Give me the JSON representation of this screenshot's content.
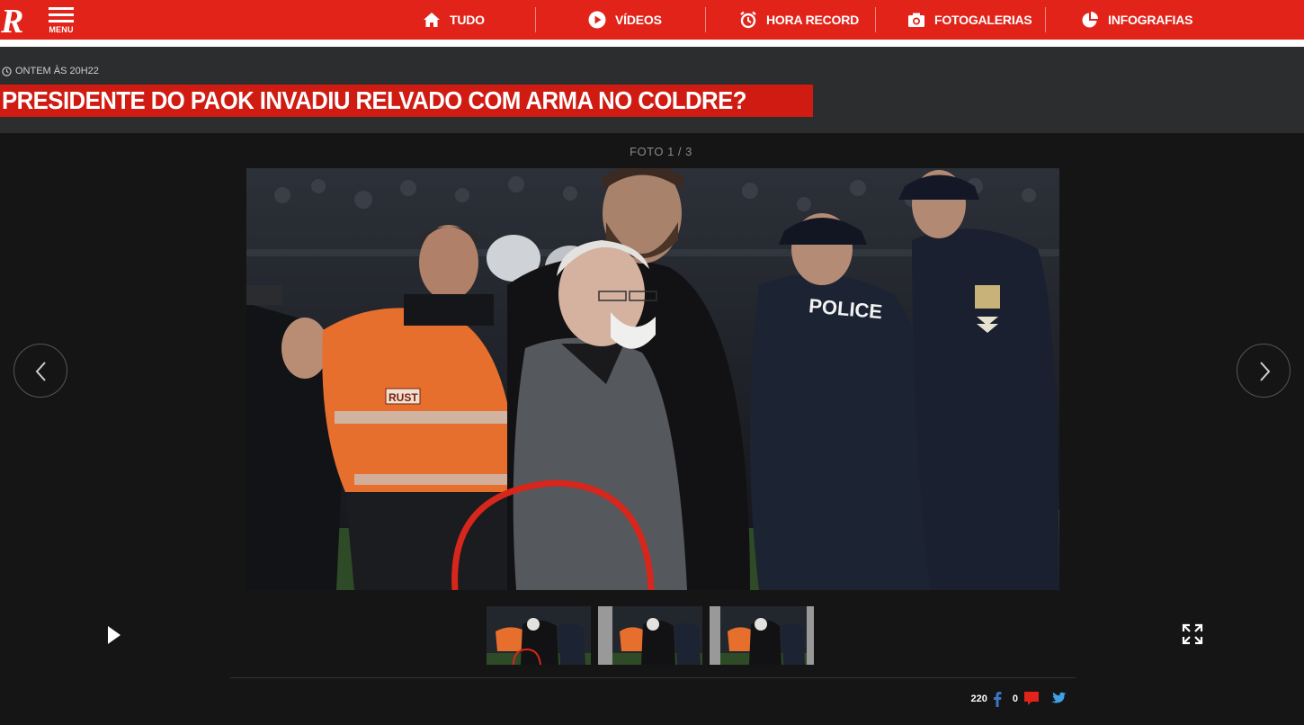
{
  "nav": {
    "logo_letter": "R",
    "menu_label": "MENU",
    "items": [
      {
        "label": "TUDO",
        "icon": "home-icon"
      },
      {
        "label": "VÍDEOS",
        "icon": "play-circle-icon"
      },
      {
        "label": "HORA RECORD",
        "icon": "alarm-clock-icon"
      },
      {
        "label": "FOTOGALERIAS",
        "icon": "camera-icon"
      },
      {
        "label": "INFOGRAFIAS",
        "icon": "pie-chart-icon"
      }
    ]
  },
  "article": {
    "timestamp": "ONTEM ÀS 20H22",
    "title": "PRESIDENTE DO PAOK INVADIU RELVADO COM ARMA NO COLDRE?"
  },
  "gallery": {
    "counter": "FOTO 1 / 3",
    "current": 1,
    "total": 3,
    "photo_overlay_text": "POLICE",
    "vest_text": "RUST"
  },
  "share": {
    "facebook_count": "220",
    "comment_count": "0"
  },
  "colors": {
    "brand_red": "#e2231a",
    "header_bg": "#2b2d2e",
    "page_bg": "#151515",
    "facebook": "#3b76c4",
    "twitter": "#3ea1e6"
  }
}
